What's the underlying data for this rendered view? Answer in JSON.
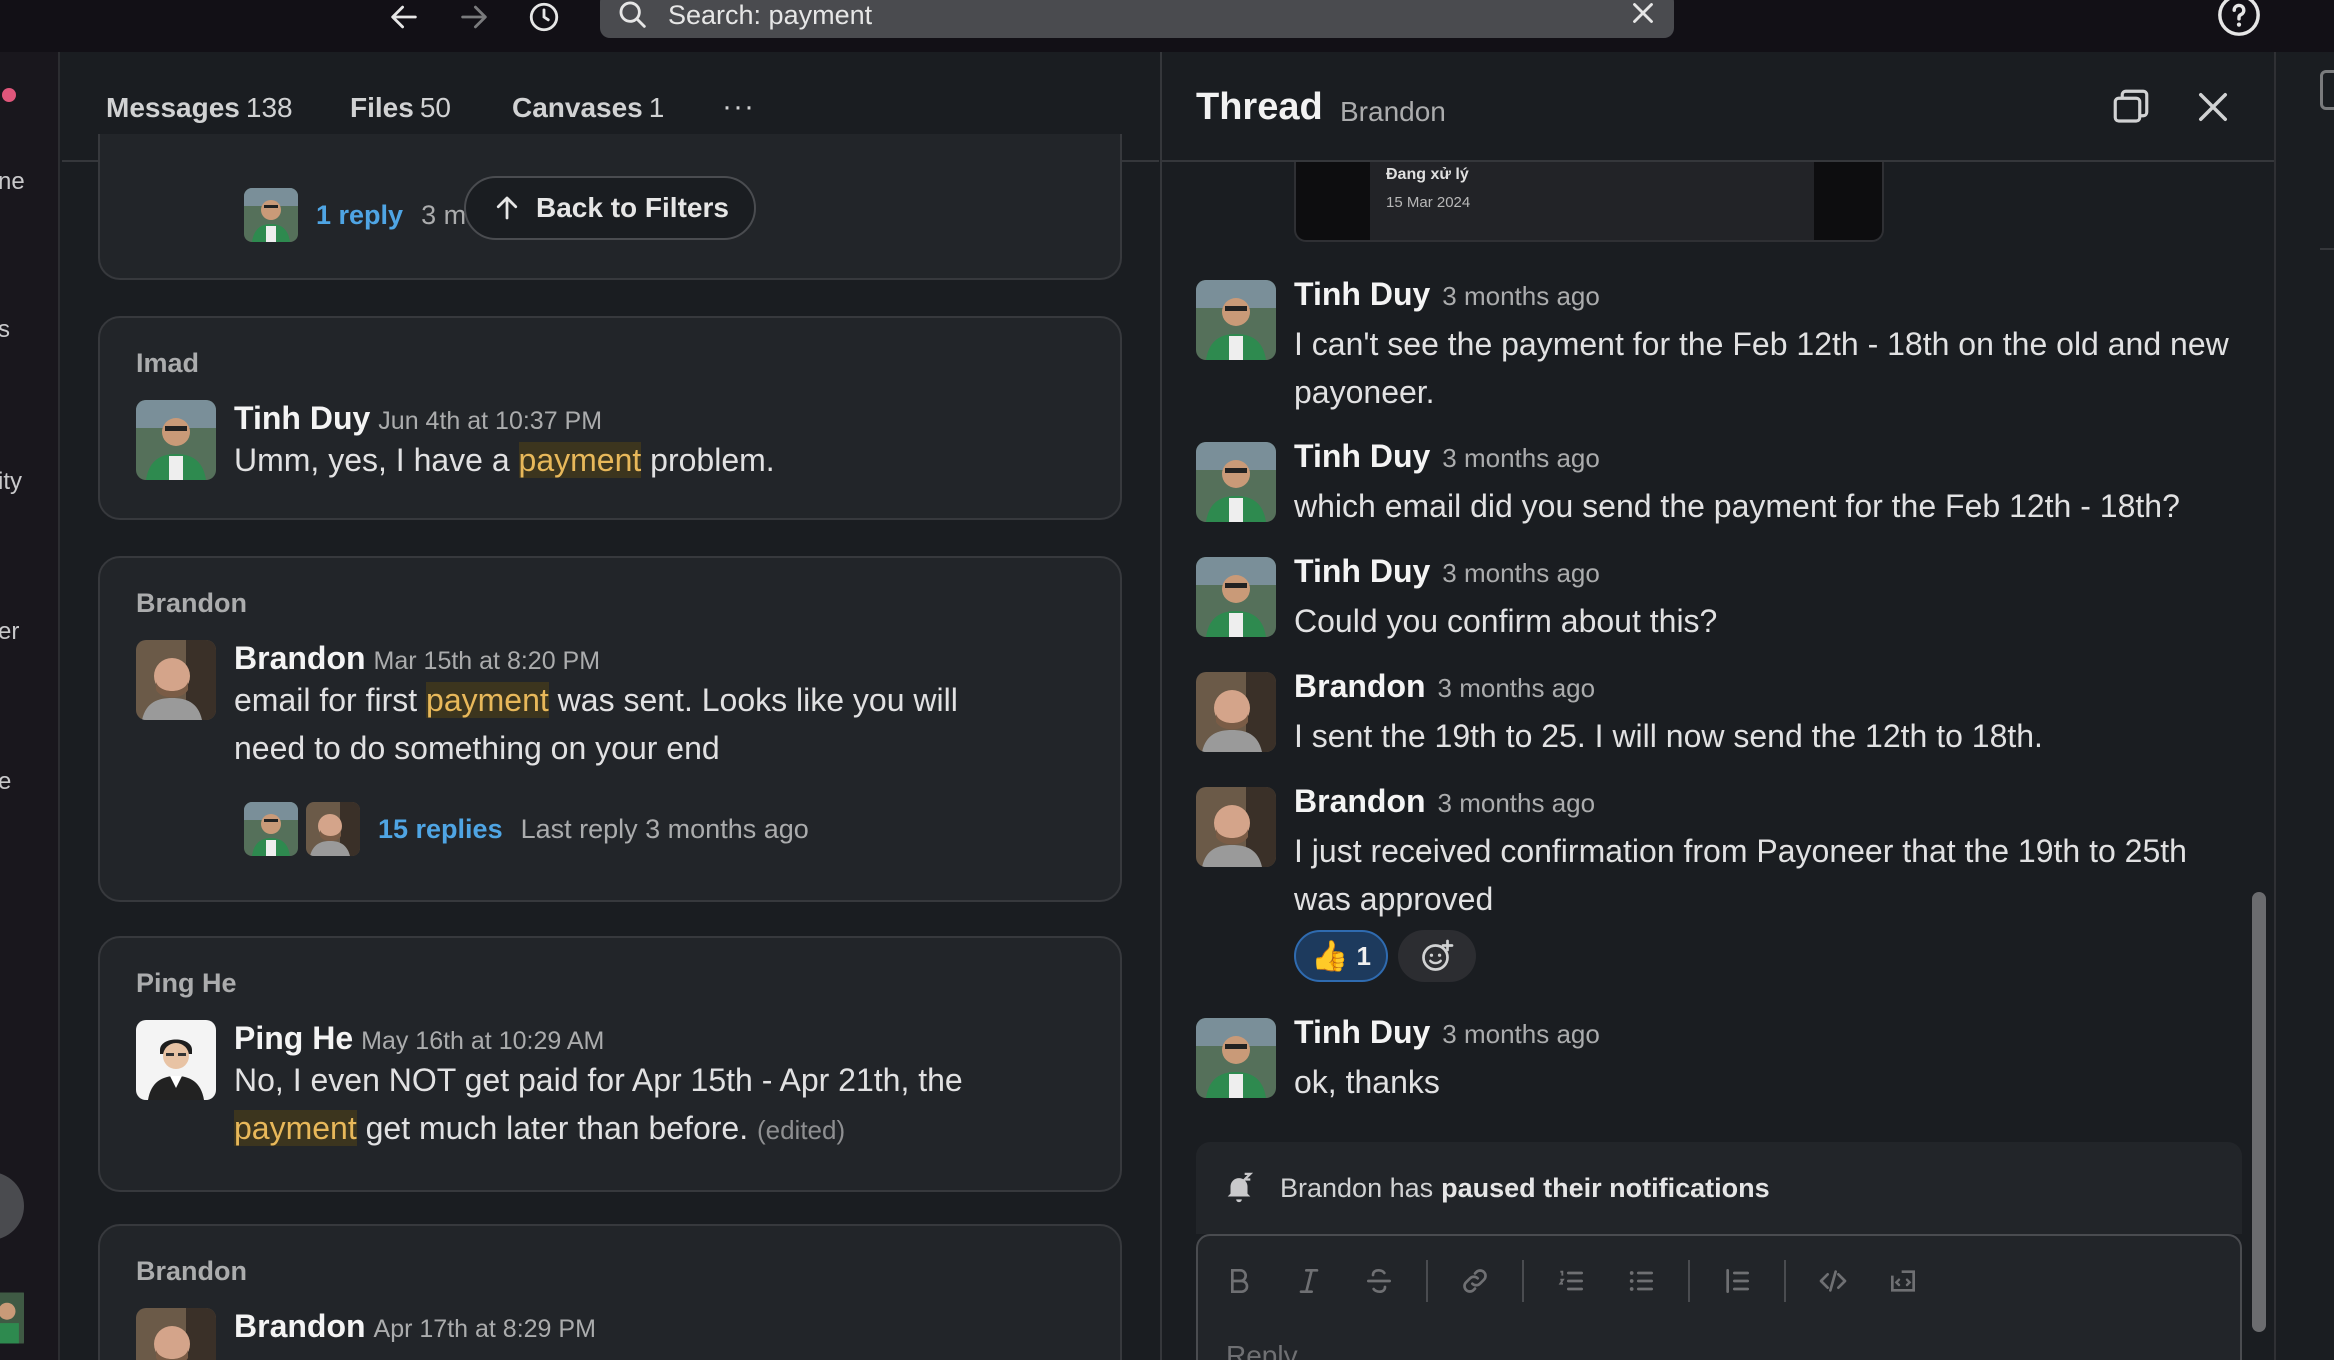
{
  "search": {
    "value": "Search: payment"
  },
  "tabs": [
    {
      "label": "Messages",
      "count": "138"
    },
    {
      "label": "Files",
      "count": "50"
    },
    {
      "label": "Canvases",
      "count": "1"
    }
  ],
  "tabs_more": "···",
  "sidebar_fragments": [
    "ne",
    "s",
    "ity",
    "er",
    "e"
  ],
  "back_to_filters": "Back to Filters",
  "results": {
    "top_card": {
      "reply_link": "1 reply",
      "reply_meta": "3 m"
    },
    "cards": [
      {
        "channel": "Imad",
        "author": "Tinh Duy",
        "time": "Jun 4th at 10:37 PM",
        "text_before": "Umm, yes, I have a ",
        "highlight": "payment",
        "text_after": " problem."
      },
      {
        "channel": "Brandon",
        "author": "Brandon",
        "time": "Mar 15th at 8:20 PM",
        "text_before": "email for first ",
        "highlight": "payment",
        "text_after": " was sent. Looks like you will need to do something on your end",
        "replies_link": "15 replies",
        "replies_meta": "Last reply 3 months ago"
      },
      {
        "channel": "Ping He",
        "author": "Ping He",
        "time": "May 16th at 10:29 AM",
        "text_before": "No, I even NOT get paid for Apr 15th - Apr 21th, the ",
        "highlight": "payment",
        "text_after": " get much later than before. ",
        "edited": "(edited)"
      },
      {
        "channel": "Brandon",
        "author": "Brandon",
        "time": "Apr 17th at 8:29 PM"
      }
    ]
  },
  "thread": {
    "title": "Thread",
    "subtitle": "Brandon",
    "preview": {
      "line1": "Đang xử lý",
      "line2": "15 Mar 2024"
    },
    "messages": [
      {
        "author": "Tinh Duy",
        "time": "3 months ago",
        "text": "I can't see the payment for the Feb 12th - 18th on the old and new payoneer."
      },
      {
        "author": "Tinh Duy",
        "time": "3 months ago",
        "text": "which email did you send the payment for the Feb 12th - 18th?"
      },
      {
        "author": "Tinh Duy",
        "time": "3 months ago",
        "text": "Could you confirm about this?"
      },
      {
        "author": "Brandon",
        "time": "3 months ago",
        "text": "I sent the 19th to 25. I will now send the 12th to 18th."
      },
      {
        "author": "Brandon",
        "time": "3 months ago",
        "text": "I just received confirmation from Payoneer that the 19th to 25th was approved"
      },
      {
        "author": "Tinh Duy",
        "time": "3 months ago",
        "text": "ok, thanks"
      }
    ],
    "reaction": {
      "emoji": "👍",
      "count": "1"
    },
    "paused_prefix": "Brandon has",
    "paused_bold": "paused their notifications",
    "reply_placeholder": "Reply..."
  },
  "colors": {
    "background": "#1a1d21",
    "card": "#222529",
    "link": "#4fa5e4",
    "highlight_bg": "#3c351e",
    "highlight_text": "#e8b85a",
    "reaction_bg": "#1d3a5d"
  }
}
